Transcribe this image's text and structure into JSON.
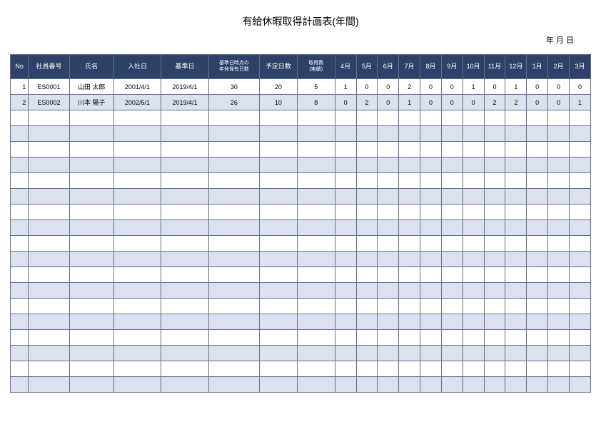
{
  "title": "有給休暇取得計画表(年間)",
  "date_line": "年 月 日",
  "headers": {
    "no": "No",
    "emp_no": "社員番号",
    "name": "氏名",
    "join_date": "入社日",
    "base_date": "基準日",
    "holding": "基準日時点の\n年休保有日数",
    "planned": "予定日数",
    "actual": "取得数\n(実績)",
    "months": [
      "4月",
      "5月",
      "6月",
      "7月",
      "8月",
      "9月",
      "10月",
      "11月",
      "12月",
      "1月",
      "2月",
      "3月"
    ]
  },
  "rows": [
    {
      "no": "1",
      "emp_no": "ES0001",
      "name": "山田 太郎",
      "join_date": "2001/4/1",
      "base_date": "2019/4/1",
      "holding": "30",
      "planned": "20",
      "actual": "5",
      "months": [
        "1",
        "0",
        "0",
        "2",
        "0",
        "0",
        "1",
        "0",
        "1",
        "0",
        "0",
        "0"
      ]
    },
    {
      "no": "2",
      "emp_no": "ES0002",
      "name": "川本 陽子",
      "join_date": "2002/5/1",
      "base_date": "2019/4/1",
      "holding": "26",
      "planned": "10",
      "actual": "8",
      "months": [
        "0",
        "2",
        "0",
        "1",
        "0",
        "0",
        "0",
        "2",
        "2",
        "0",
        "0",
        "1"
      ]
    }
  ],
  "empty_rows": 18
}
